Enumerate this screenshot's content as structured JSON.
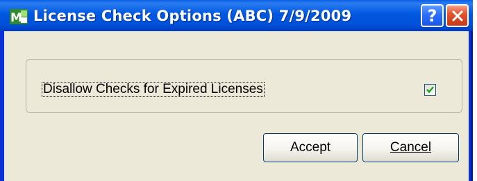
{
  "window": {
    "title": "License Check Options (ABC) 7/9/2009",
    "app_icon_text": "M",
    "help_label": "?",
    "colors": {
      "titlebar": "#0058e0",
      "client": "#ece9d8",
      "close": "#e2552f"
    }
  },
  "group": {
    "option_label": "Disallow Checks for Expired Licenses",
    "option_checked": true
  },
  "buttons": {
    "accept_label": "Accept",
    "cancel_label": "Cancel"
  }
}
